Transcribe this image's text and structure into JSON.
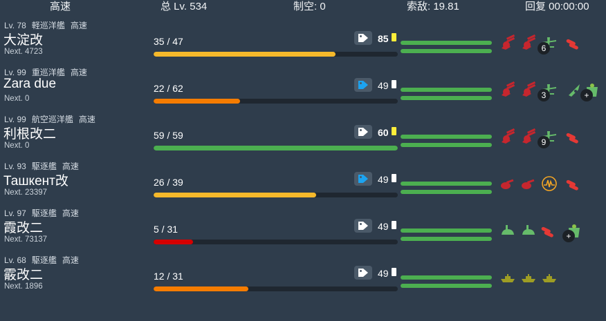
{
  "header": {
    "speed": "高速",
    "total_level": "总 Lv. 534",
    "air_control": "制空: 0",
    "los": "索敌: 19.81",
    "repair": "回复 00:00:00"
  },
  "colors": {
    "bg": "#2f3d4c",
    "hp_yellow": "#f6b92b",
    "hp_orange": "#f57c00",
    "hp_red": "#d50000",
    "hp_green": "#4caf50",
    "tag_blue": "#1ca3f0",
    "sparkle_yellow": "#ffee3a",
    "gun_red": "#c6262e",
    "torp_red": "#e53935",
    "plane_green": "#66bb6a",
    "lc_olive": "#9e9d24"
  },
  "ships": [
    {
      "level": "Lv. 78",
      "type": "軽巡洋艦",
      "speed": "高速",
      "name": "大淀改",
      "next": "Next. 4723",
      "hp": "35 / 47",
      "hp_ratio": 0.745,
      "hp_color": "yellow",
      "tag_color": "white",
      "condition": "85",
      "cond_bold": true,
      "fuel": "yellow",
      "equips": [
        {
          "icon": "main-gun-icon",
          "badge": ""
        },
        {
          "icon": "main-gun-icon",
          "badge": ""
        },
        {
          "icon": "seaplane-icon",
          "badge": "6"
        },
        {
          "icon": "torpedo-icon",
          "badge": ""
        }
      ]
    },
    {
      "level": "Lv. 99",
      "type": "重巡洋艦",
      "speed": "高速",
      "name": "Zara due",
      "next": "Next. 0",
      "hp": "22 / 62",
      "hp_ratio": 0.355,
      "hp_color": "orange",
      "tag_color": "blue",
      "condition": "49",
      "cond_bold": false,
      "fuel": "white",
      "equips": [
        {
          "icon": "main-gun-icon",
          "badge": ""
        },
        {
          "icon": "main-gun-icon",
          "badge": ""
        },
        {
          "icon": "seaplane-icon",
          "badge": "3"
        },
        {
          "icon": "aa-shell-icon",
          "badge": ""
        },
        {
          "icon": "repair-goddess-icon",
          "badge": "+"
        }
      ]
    },
    {
      "level": "Lv. 99",
      "type": "航空巡洋艦",
      "speed": "高速",
      "name": "利根改二",
      "next": "Next. 0",
      "hp": "59 / 59",
      "hp_ratio": 1.0,
      "hp_color": "green",
      "tag_color": "white",
      "condition": "60",
      "cond_bold": true,
      "fuel": "yellow",
      "equips": [
        {
          "icon": "main-gun-icon",
          "badge": ""
        },
        {
          "icon": "main-gun-icon",
          "badge": ""
        },
        {
          "icon": "seaplane-icon",
          "badge": "9"
        },
        {
          "icon": "torpedo-icon",
          "badge": ""
        }
      ]
    },
    {
      "level": "Lv. 93",
      "type": "駆逐艦",
      "speed": "高速",
      "name": "Ташкент改",
      "next": "Next. 23397",
      "hp": "26 / 39",
      "hp_ratio": 0.667,
      "hp_color": "yellow",
      "tag_color": "blue",
      "condition": "49",
      "cond_bold": false,
      "fuel": "white",
      "equips": [
        {
          "icon": "small-gun-icon",
          "badge": ""
        },
        {
          "icon": "small-gun-icon",
          "badge": ""
        },
        {
          "icon": "radar-icon",
          "badge": ""
        },
        {
          "icon": "torpedo-icon",
          "badge": ""
        }
      ]
    },
    {
      "level": "Lv. 97",
      "type": "駆逐艦",
      "speed": "高速",
      "name": "霞改二",
      "next": "Next. 73137",
      "hp": "5 / 31",
      "hp_ratio": 0.161,
      "hp_color": "red",
      "tag_color": "white",
      "condition": "49",
      "cond_bold": false,
      "fuel": "white",
      "equips": [
        {
          "icon": "green-gun-icon",
          "badge": ""
        },
        {
          "icon": "green-gun-icon",
          "badge": ""
        },
        {
          "icon": "torpedo-icon",
          "badge": ""
        },
        {
          "icon": "repair-goddess-icon",
          "badge": "+"
        }
      ]
    },
    {
      "level": "Lv. 68",
      "type": "駆逐艦",
      "speed": "高速",
      "name": "霰改二",
      "next": "Next. 1896",
      "hp": "12 / 31",
      "hp_ratio": 0.387,
      "hp_color": "orange",
      "tag_color": "white",
      "condition": "49",
      "cond_bold": false,
      "fuel": "white",
      "equips": [
        {
          "icon": "landing-craft-icon",
          "badge": ""
        },
        {
          "icon": "landing-craft-icon",
          "badge": ""
        },
        {
          "icon": "landing-craft-icon",
          "badge": ""
        }
      ]
    }
  ]
}
